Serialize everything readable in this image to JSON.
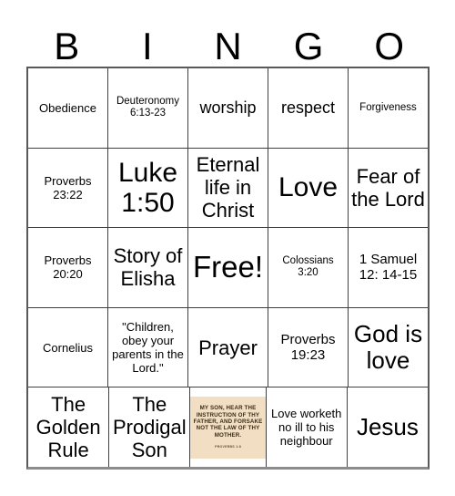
{
  "card": {
    "title": "Bingo Card",
    "header_letters": [
      "B",
      "I",
      "N",
      "G",
      "O"
    ],
    "colors": {
      "grid_border": "#404040",
      "grid_outer_border": "#595959",
      "text": "#000000",
      "image_background": "#f2dfc3",
      "image_text": "#3b2a17",
      "page_background": "#ffffff"
    },
    "rows": [
      {
        "cells": [
          {
            "text": "Obedience",
            "size": "sm",
            "free": false
          },
          {
            "text": "Deuteronomy 6:13-23",
            "size": "xs",
            "free": false
          },
          {
            "text": "worship",
            "size": "lg",
            "free": false
          },
          {
            "text": "respect",
            "size": "lg",
            "free": false
          },
          {
            "text": "Forgiveness",
            "size": "xs",
            "free": false
          }
        ]
      },
      {
        "cells": [
          {
            "text": "Proverbs 23:22",
            "size": "sm",
            "free": false
          },
          {
            "text": "Luke 1:50",
            "size": "3xl",
            "free": false
          },
          {
            "text": "Eternal life in Christ",
            "size": "xl",
            "free": false
          },
          {
            "text": "Love",
            "size": "3xl",
            "free": false
          },
          {
            "text": "Fear of the Lord",
            "size": "xl",
            "free": false
          }
        ]
      },
      {
        "cells": [
          {
            "text": "Proverbs 20:20",
            "size": "sm",
            "free": false
          },
          {
            "text": "Story of Elisha",
            "size": "xl",
            "free": false
          },
          {
            "text": "Free!",
            "size": "4xl",
            "free": true
          },
          {
            "text": "Colossians 3:20",
            "size": "xs",
            "free": false
          },
          {
            "text": "1 Samuel 12: 14-15",
            "size": "md",
            "free": false
          }
        ]
      },
      {
        "cells": [
          {
            "text": "Cornelius",
            "size": "sm",
            "free": false
          },
          {
            "text": "\"Children, obey your parents in the Lord.\"",
            "size": "sm",
            "free": false
          },
          {
            "text": "Prayer",
            "size": "xl",
            "free": false
          },
          {
            "text": "Proverbs 19:23",
            "size": "md",
            "free": false
          },
          {
            "text": "God is love",
            "size": "2xl",
            "free": false
          }
        ]
      },
      {
        "cells": [
          {
            "text": "The Golden Rule",
            "size": "xl",
            "free": false
          },
          {
            "text": "The Prodigal Son",
            "size": "xl",
            "free": false
          },
          {
            "text": "",
            "size": "xs",
            "free": false,
            "image": true
          },
          {
            "text": "Love worketh no ill to his neighbour",
            "size": "sm",
            "free": false
          },
          {
            "text": "Jesus",
            "size": "2xl",
            "free": false
          }
        ]
      }
    ],
    "image_cell": {
      "verse_text": "My son, hear the instruction of thy father, and forsake not the law of thy mother.",
      "verse_reference": "Proverbs 1:8"
    }
  }
}
